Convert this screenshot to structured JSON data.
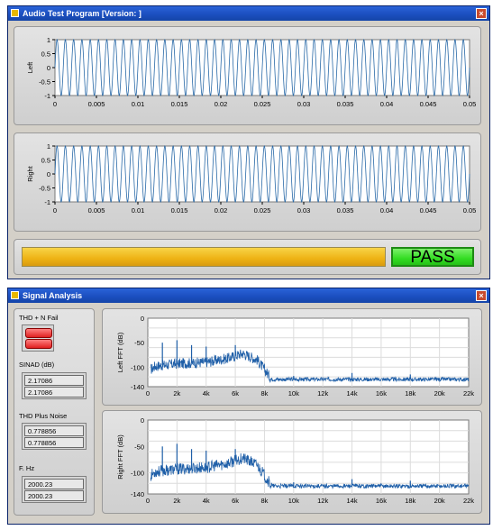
{
  "window1": {
    "title": "Audio Test Program [Version: ]"
  },
  "window2": {
    "title": "Signal Analysis"
  },
  "close_glyph": "×",
  "graph_left": {
    "ylabel": "Left",
    "yticks": [
      "1",
      "0.5",
      "0",
      "-0.5",
      "-1"
    ],
    "xticks": [
      "0",
      "0.005",
      "0.01",
      "0.015",
      "0.02",
      "0.025",
      "0.03",
      "0.035",
      "0.04",
      "0.045",
      "0.05"
    ]
  },
  "graph_right": {
    "ylabel": "Right",
    "yticks": [
      "1",
      "0.5",
      "0",
      "-0.5",
      "-1"
    ],
    "xticks": [
      "0",
      "0.005",
      "0.01",
      "0.015",
      "0.02",
      "0.025",
      "0.03",
      "0.035",
      "0.04",
      "0.045",
      "0.05"
    ]
  },
  "progress": {
    "value": 1.0,
    "color": "#f0b818"
  },
  "result": {
    "label": "PASS",
    "color": "#33dd22"
  },
  "thd_fail": {
    "label": "THD + N Fail"
  },
  "sinad": {
    "label": "SINAD (dB)",
    "values": [
      "2.17086",
      "2.17086"
    ]
  },
  "thd_noise": {
    "label": "THD Plus Noise",
    "values": [
      "0.778856",
      "0.778856"
    ]
  },
  "freq": {
    "label": "F. Hz",
    "values": [
      "2000.23",
      "2000.23"
    ]
  },
  "fft_left": {
    "ylabel": "Left FFT (dB)",
    "yticks": [
      "0",
      "-50",
      "-100",
      "-140"
    ],
    "xticks": [
      "0",
      "2k",
      "4k",
      "6k",
      "8k",
      "10k",
      "12k",
      "14k",
      "16k",
      "18k",
      "20k",
      "22k"
    ]
  },
  "fft_right": {
    "ylabel": "Right FFT (dB)",
    "yticks": [
      "0",
      "-50",
      "-100",
      "-140"
    ],
    "xticks": [
      "0",
      "2k",
      "4k",
      "6k",
      "8k",
      "10k",
      "12k",
      "14k",
      "16k",
      "18k",
      "20k",
      "22k"
    ]
  },
  "chart_data": [
    {
      "type": "line",
      "title": "",
      "xlabel": "",
      "ylabel": "Left",
      "xlim": [
        0,
        0.05
      ],
      "ylim": [
        -1,
        1
      ],
      "grid": false,
      "series": [
        {
          "waveform": "sine",
          "amplitude": 1,
          "frequency_hz": 1000,
          "color": "#2a6aa8"
        }
      ]
    },
    {
      "type": "line",
      "title": "",
      "xlabel": "",
      "ylabel": "Right",
      "xlim": [
        0,
        0.05
      ],
      "ylim": [
        -1,
        1
      ],
      "grid": false,
      "series": [
        {
          "waveform": "sine",
          "amplitude": 1,
          "frequency_hz": 1000,
          "color": "#2a6aa8"
        }
      ]
    },
    {
      "type": "line",
      "title": "",
      "xlabel": "",
      "ylabel": "Left FFT (dB)",
      "xlim": [
        0,
        22000
      ],
      "ylim": [
        -140,
        0
      ],
      "grid": true,
      "series": [
        {
          "color": "#1f5fa8",
          "envelope_x": [
            0,
            500,
            2000,
            4000,
            5500,
            6500,
            7500,
            8500,
            22000
          ],
          "envelope_y": [
            -110,
            -98,
            -93,
            -90,
            -82,
            -72,
            -85,
            -125,
            -125
          ],
          "peaks_x": [
            1000,
            2000,
            3000,
            4000,
            6000,
            10000,
            14000,
            18000
          ],
          "peaks_y": [
            -50,
            -45,
            -55,
            -58,
            -55,
            -118,
            -112,
            -115
          ]
        }
      ]
    },
    {
      "type": "line",
      "title": "",
      "xlabel": "",
      "ylabel": "Right FFT (dB)",
      "xlim": [
        0,
        22000
      ],
      "ylim": [
        -140,
        0
      ],
      "grid": true,
      "series": [
        {
          "color": "#1f5fa8",
          "envelope_x": [
            0,
            500,
            2000,
            4000,
            5500,
            6500,
            7500,
            8500,
            22000
          ],
          "envelope_y": [
            -110,
            -98,
            -93,
            -90,
            -82,
            -72,
            -85,
            -125,
            -125
          ],
          "peaks_x": [
            1000,
            2000,
            3000,
            4000,
            6000,
            10000,
            14000,
            18000
          ],
          "peaks_y": [
            -50,
            -45,
            -55,
            -58,
            -55,
            -118,
            -112,
            -115
          ]
        }
      ]
    }
  ]
}
